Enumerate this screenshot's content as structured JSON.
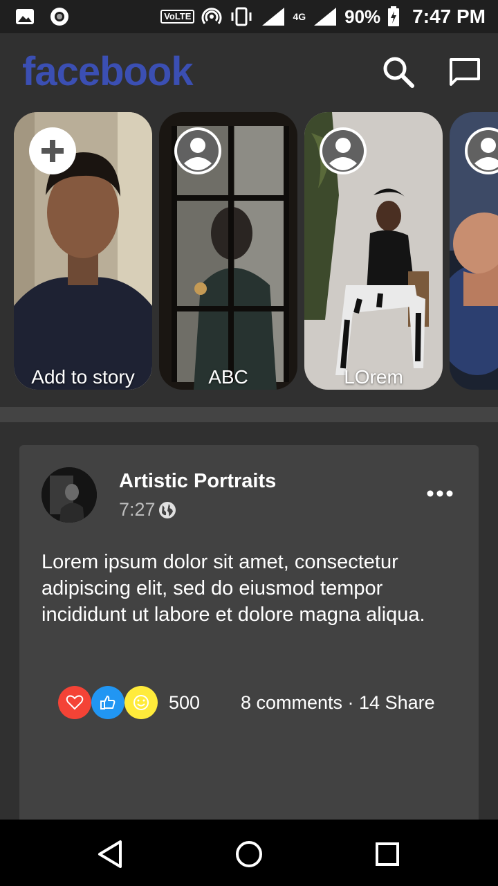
{
  "status_bar": {
    "volte": "VoLTE",
    "network": "4G",
    "battery": "90%",
    "time": "7:47 PM"
  },
  "app": {
    "logo": "facebook",
    "brand_color": "#3b4fb3",
    "icons": [
      "search-icon",
      "messenger-icon"
    ]
  },
  "stories": [
    {
      "label": "Add to story",
      "icon": "add-icon"
    },
    {
      "label": "ABC",
      "icon": "person-icon"
    },
    {
      "label": "LOrem",
      "icon": "person-icon"
    },
    {
      "label": "",
      "icon": "person-icon"
    }
  ],
  "post": {
    "author": "Artistic Portraits",
    "time": "7:27",
    "text": "Lorem ipsum dolor sit amet, consectetur adipiscing elit, sed do eiusmod tempor incididunt ut labore et dolore magna aliqua.",
    "reaction_count": "500",
    "engagement": "8 comments · 14 Share",
    "reactions": [
      {
        "name": "love-icon",
        "color": "#f44336"
      },
      {
        "name": "like-icon",
        "color": "#2196f3"
      },
      {
        "name": "haha-icon",
        "color": "#ffeb3b"
      }
    ]
  },
  "nav": [
    "back-icon",
    "home-icon",
    "recents-icon"
  ]
}
